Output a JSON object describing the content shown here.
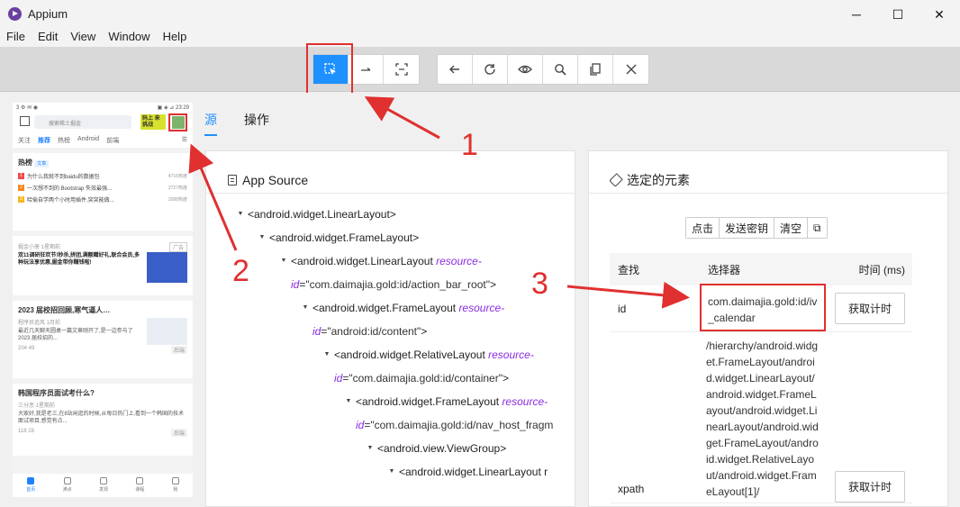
{
  "window": {
    "title": "Appium",
    "minimize": "─",
    "maximize": "☐",
    "close": "✕"
  },
  "menu": [
    "File",
    "Edit",
    "View",
    "Window",
    "Help"
  ],
  "toolbar": {
    "group1": [
      "select-elements-icon",
      "swipe-icon",
      "tap-by-coordinates-icon"
    ],
    "group2": [
      "back-icon",
      "refresh-icon",
      "show-hide-icon",
      "search-icon",
      "copy-xml-icon",
      "quit-session-icon"
    ]
  },
  "phone": {
    "status_left": "3 ⚙ ✉ ◉",
    "status_right": "▣ ◈ ⊿ 23:29",
    "search_placeholder": "搜索稀土掘金",
    "banner_text": "码上 来挑战",
    "tabs": [
      "关注",
      "推荐",
      "热榜",
      "Android",
      "前端"
    ],
    "hot": {
      "title": "热榜",
      "badge": "文章",
      "items": [
        {
          "n": "1",
          "text": "为什么我就不到baidu的数据包",
          "heat": "4716热度",
          "color": "#f04a4a"
        },
        {
          "n": "2",
          "text": "一次想不到的 Bootstrap 失效最强...",
          "heat": "2727热度",
          "color": "#f5871f"
        },
        {
          "n": "3",
          "text": "哈偷自学两个小时用插件,突突能做...",
          "heat": "2088热度",
          "color": "#f5b81f"
        }
      ]
    },
    "ad": {
      "meta": "掘金小册  1星期前",
      "tag": "广告",
      "body": "双11调研狂欢节!秒杀,拼团,满额赠好礼,联合会员,多种玩法享优惠,掘金带你赚钱啦!"
    },
    "post1": {
      "title": "2023 届校招回顾,寒气逼人…",
      "meta": "程序员追风  1月前",
      "body": "最近几天聊天圆桌一篇文章刚开了,是一边参与了 2023 届校招的...",
      "stats": "204  49",
      "tag": "后端"
    },
    "post2": {
      "title": "韩国程序员面试考什么?",
      "meta": "三分恶  1星期前",
      "body": "大家好,我是老三,在8站闲逛的时候,从每日热门上,看到一个韩国的技术面试项目,感觉有点...",
      "stats": "118  28",
      "tag": "后端"
    },
    "bottom": [
      "首页",
      "沸点",
      "发现",
      "课程",
      "我"
    ]
  },
  "tabs": [
    "源",
    "操作"
  ],
  "source": {
    "title": "App Source",
    "nodes": [
      {
        "tag": "<android.widget.LinearLayout>",
        "attr": "",
        "val": "",
        "tail": ""
      },
      {
        "tag": "<android.widget.FrameLayout>",
        "attr": "",
        "val": "",
        "tail": ""
      },
      {
        "tag": "<android.widget.LinearLayout ",
        "attr": "resource-id",
        "val": "=\"com.daimajia.gold:id/action_bar_root\"",
        "tail": ">"
      },
      {
        "tag": "<android.widget.FrameLayout ",
        "attr": "resource-id",
        "val": "=\"android:id/content\"",
        "tail": ">"
      },
      {
        "tag": "<android.widget.RelativeLayout ",
        "attr": "resource-id",
        "val": "=\"com.daimajia.gold:id/container\"",
        "tail": ">"
      },
      {
        "tag": "<android.widget.FrameLayout ",
        "attr": "resource-id",
        "val": "=\"com.daimajia.gold:id/nav_host_fragm",
        "tail": ""
      },
      {
        "tag": "<android.view.ViewGroup>",
        "attr": "",
        "val": "",
        "tail": ""
      },
      {
        "tag": "<android.widget.LinearLayout r",
        "attr": "",
        "val": "",
        "tail": ""
      }
    ]
  },
  "selected": {
    "title": "选定的元素",
    "actions": [
      "点击",
      "发送密钥",
      "清空",
      "⧉"
    ],
    "headers": [
      "查找",
      "选择器",
      "时间 (ms)"
    ],
    "rows": [
      {
        "by": "id",
        "selector": "com.daimajia.gold:id/iv_calendar",
        "button": "获取计时"
      },
      {
        "by": "xpath",
        "selector": "/hierarchy/android.widget.FrameLayout/android.widget.LinearLayout/android.widget.FrameLayout/android.widget.LinearLayout/android.widget.FrameLayout/android.widget.RelativeLayout/android.widget.FrameLayout[1]/",
        "button": "获取计时"
      }
    ]
  },
  "annotations": [
    "1",
    "2",
    "3"
  ]
}
